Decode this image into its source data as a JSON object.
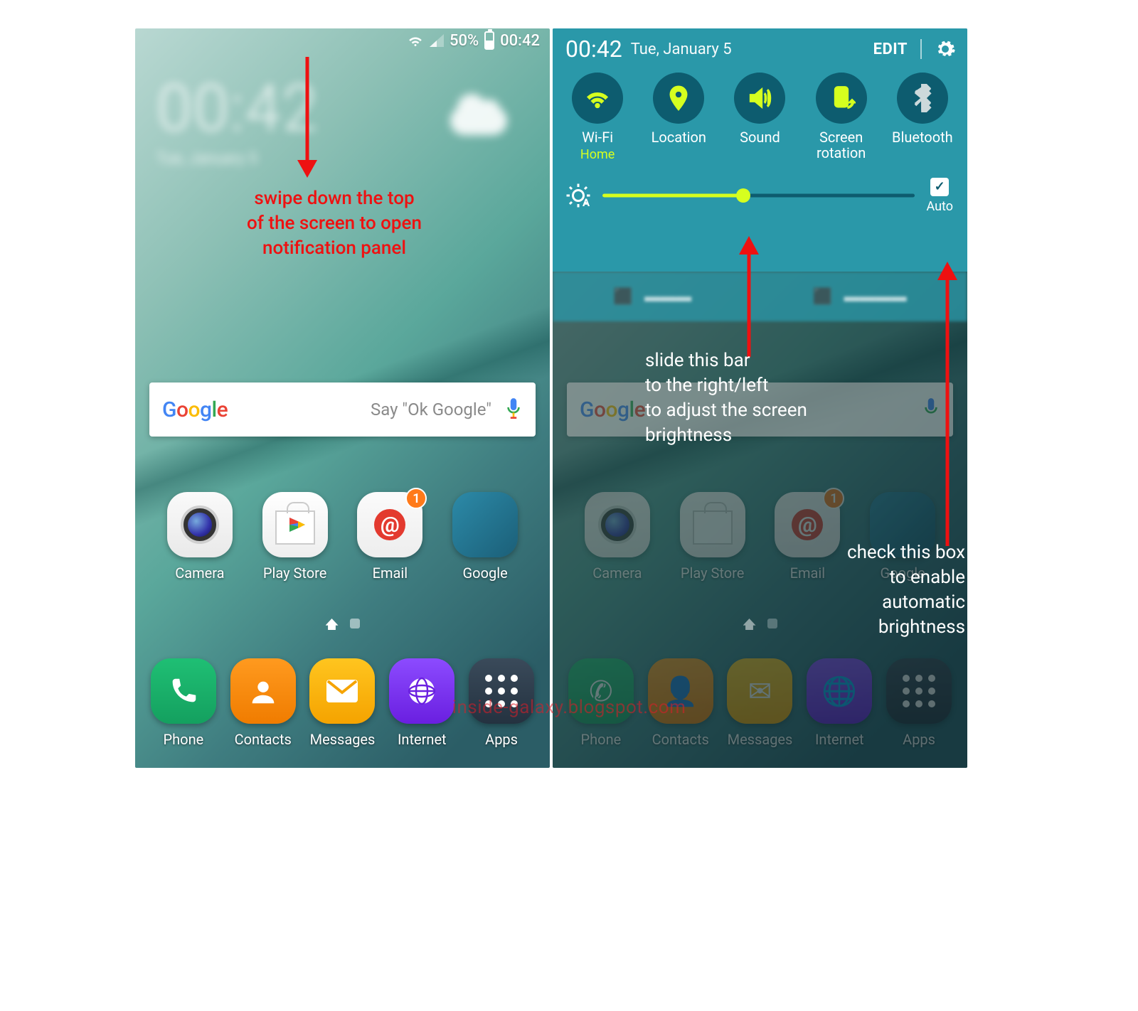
{
  "status": {
    "battery": "50%",
    "time": "00:42"
  },
  "home": {
    "clock_time": "00:42",
    "clock_date": "Tue, January 5",
    "search_placeholder": "Say \"Ok Google\"",
    "apps_mid": [
      {
        "name": "Camera"
      },
      {
        "name": "Play Store"
      },
      {
        "name": "Email",
        "badge": "1"
      },
      {
        "name": "Google"
      }
    ],
    "dock": [
      {
        "name": "Phone"
      },
      {
        "name": "Contacts"
      },
      {
        "name": "Messages"
      },
      {
        "name": "Internet"
      },
      {
        "name": "Apps"
      }
    ]
  },
  "panel": {
    "time": "00:42",
    "date": "Tue, January 5",
    "edit": "EDIT",
    "toggles": [
      {
        "label": "Wi-Fi",
        "sub": "Home",
        "on": true,
        "icon": "wifi"
      },
      {
        "label": "Location",
        "on": true,
        "icon": "location"
      },
      {
        "label": "Sound",
        "on": true,
        "icon": "sound"
      },
      {
        "label": "Screen rotation",
        "on": true,
        "icon": "rotation"
      },
      {
        "label": "Bluetooth",
        "on": false,
        "icon": "bluetooth"
      }
    ],
    "brightness_pct": 45,
    "auto_label": "Auto",
    "auto_checked": true
  },
  "annotations": {
    "a1": "swipe down the top\nof the screen to open\nnotification panel",
    "a2": "slide this bar\nto the right/left\nto adjust the screen\nbrightness",
    "a3": "check this box\nto enable\nautomatic\nbrightness"
  },
  "watermark": "inside-galaxy.blogspot.com"
}
